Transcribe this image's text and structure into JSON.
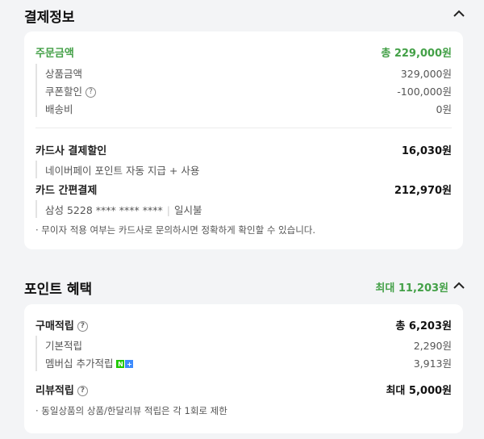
{
  "payment": {
    "title": "결제정보",
    "order_amount_label": "주문금액",
    "order_amount_value": "총 229,000원",
    "product_label": "상품금액",
    "product_value": "329,000원",
    "coupon_label": "쿠폰할인",
    "coupon_value": "-100,000원",
    "shipping_label": "배송비",
    "shipping_value": "0원",
    "card_discount_label": "카드사 결제할인",
    "card_discount_value": "16,030원",
    "card_discount_detail": "네이버페이 포인트 자동 지급 + 사용",
    "easy_pay_label": "카드 간편결제",
    "easy_pay_value": "212,970원",
    "card_info": "삼성 5228 **** **** ****",
    "installment": "일시불",
    "notice": "· 무이자 적용 여부는 카드사로 문의하시면 정확하게 확인할 수 있습니다."
  },
  "points": {
    "title": "포인트 혜택",
    "max_label": "최대 11,203원",
    "purchase_label": "구매적립",
    "purchase_value": "총 6,203원",
    "basic_label": "기본적립",
    "basic_value": "2,290원",
    "membership_label": "멤버십 추가적립",
    "membership_value": "3,913원",
    "review_label": "리뷰적립",
    "review_value": "최대 5,000원",
    "notice": "· 동일상품의 상품/한달리뷰 적립은 각 1회로 제한"
  },
  "icons": {
    "collapse": "chevron-up-icon",
    "help": "question-circle-icon",
    "membership_badge": "naver-plus-badge-icon"
  },
  "colors": {
    "accent_green": "#43a047"
  }
}
